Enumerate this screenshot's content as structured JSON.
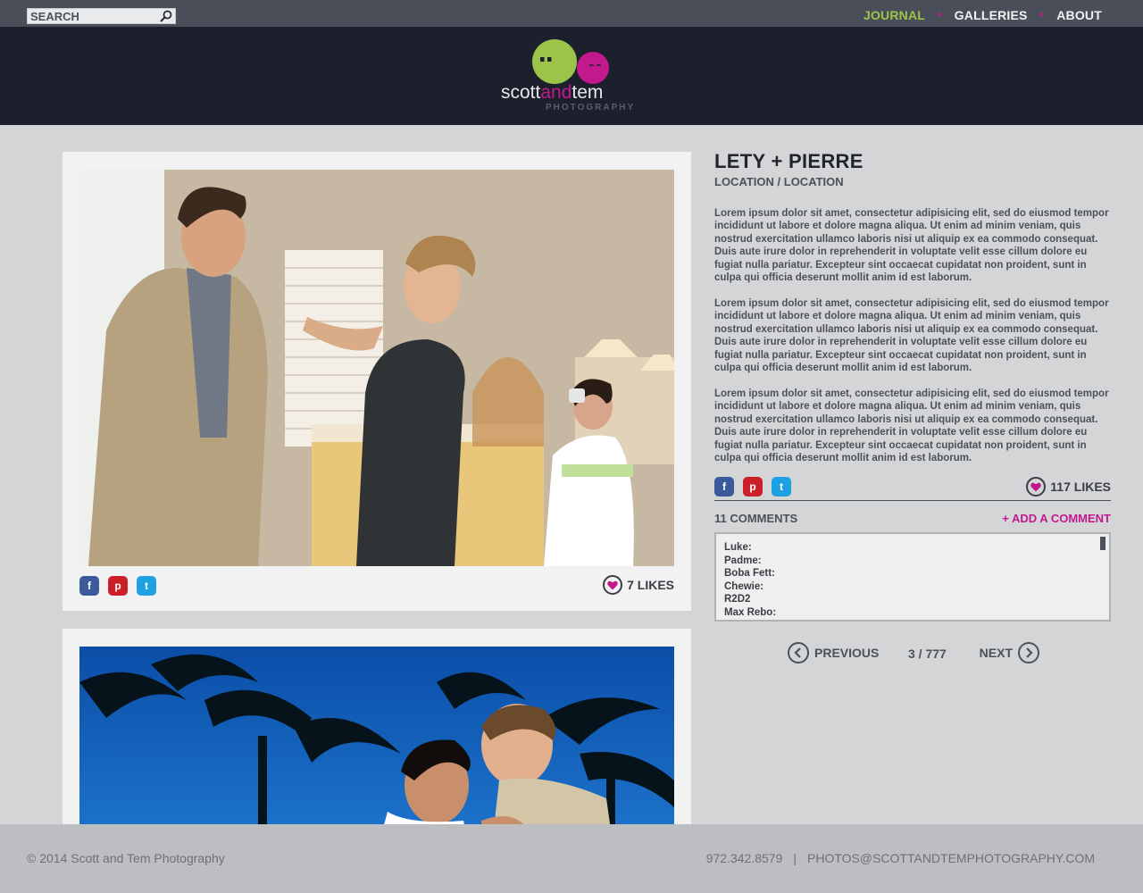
{
  "search": {
    "placeholder": "SEARCH"
  },
  "nav": {
    "items": [
      {
        "label": "JOURNAL",
        "active": true
      },
      {
        "label": "GALLERIES",
        "active": false
      },
      {
        "label": "ABOUT",
        "active": false
      }
    ],
    "separator": "+"
  },
  "logo": {
    "word_scott": "scott",
    "word_and": "and",
    "word_tem": "tem",
    "tagline": "PHOTOGRAPHY"
  },
  "colors": {
    "accent_green": "#9cc44a",
    "accent_magenta": "#c21a8d",
    "header_bg": "#1c1f2c",
    "topbar_bg": "#4a4e58"
  },
  "posts": [
    {
      "photo_alt": "groom adjusting tie with bridesmaid in hotel room",
      "likes": "7 LIKES"
    },
    {
      "photo_alt": "bride and groom under palm trees"
    }
  ],
  "social": {
    "facebook": "f",
    "pinterest": "p",
    "twitter": "t"
  },
  "article": {
    "title": "LETY + PIERRE",
    "location": "LOCATION / LOCATION",
    "paragraphs": [
      "Lorem ipsum dolor sit amet, consectetur adipisicing elit, sed do eiusmod tempor incididunt ut labore et dolore magna aliqua. Ut enim ad minim veniam, quis nostrud exercitation ullamco laboris nisi ut aliquip ex ea commodo consequat. Duis aute irure dolor in reprehenderit in voluptate velit esse cillum dolore eu fugiat nulla pariatur. Excepteur sint occaecat cupidatat non proident, sunt in culpa qui officia deserunt mollit anim id est laborum.",
      "Lorem ipsum dolor sit amet, consectetur adipisicing elit, sed do eiusmod tempor incididunt ut labore et dolore magna aliqua. Ut enim ad minim veniam, quis nostrud exercitation ullamco laboris nisi ut aliquip ex ea commodo consequat. Duis aute irure dolor in reprehenderit in voluptate velit esse cillum dolore eu fugiat nulla pariatur. Excepteur sint occaecat cupidatat non proident, sunt in culpa qui officia deserunt mollit anim id est laborum.",
      "Lorem ipsum dolor sit amet, consectetur adipisicing elit, sed do eiusmod tempor incididunt ut labore et dolore magna aliqua. Ut enim ad minim veniam, quis nostrud exercitation ullamco laboris nisi ut aliquip ex ea commodo consequat. Duis aute irure dolor in reprehenderit in voluptate velit esse cillum dolore eu fugiat nulla pariatur. Excepteur sint occaecat cupidatat non proident, sunt in culpa qui officia deserunt mollit anim id est laborum."
    ],
    "likes": "117 LIKES",
    "comments_label": "11 COMMENTS",
    "add_comment_label": "+ ADD A COMMENT",
    "comments": [
      "Luke:",
      "Padme:",
      "Boba Fett:",
      "Chewie:",
      "R2D2",
      "Max Rebo:"
    ]
  },
  "pager": {
    "previous_label": "PREVIOUS",
    "next_label": "NEXT",
    "count": "3 / 777"
  },
  "footer": {
    "copyright": "© 2014 Scott and Tem Photography",
    "phone": "972.342.8579",
    "divider": "|",
    "email": "PHOTOS@SCOTTANDTEMPHOTOGRAPHY.COM"
  }
}
